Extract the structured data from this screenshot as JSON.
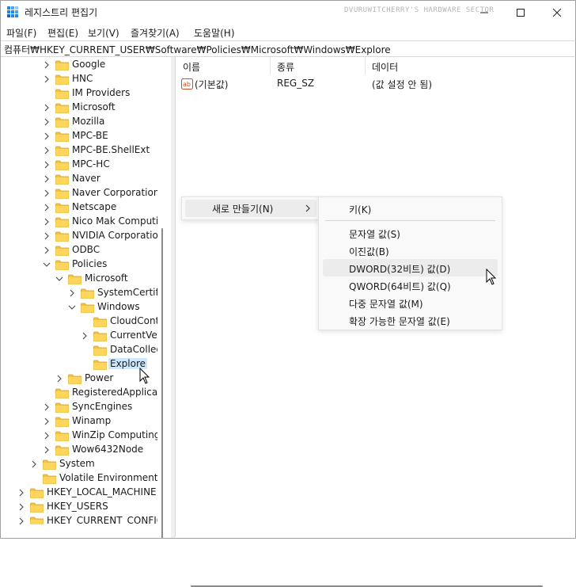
{
  "window": {
    "title": "레지스트리 편집기",
    "watermark": "DVURUWITCHERRY'S HARDWARE SECTOR",
    "minimize_icon": "minimize-icon",
    "maximize_icon": "maximize-icon",
    "close_icon": "close-icon"
  },
  "menu": [
    "파일(F)",
    "편집(E)",
    "보기(V)",
    "즐겨찾기(A)",
    "도움말(H)"
  ],
  "address": "컴퓨터₩HKEY_CURRENT_USER₩Software₩Policies₩Microsoft₩Windows₩Explore",
  "tree": [
    "Google",
    "HNC",
    "IM Providers",
    "Microsoft",
    "Mozilla",
    "MPC-BE",
    "MPC-BE.ShellExt",
    "MPC-HC",
    "Naver",
    "Naver Corporation",
    "Netscape",
    "Nico Mak Computing",
    "NVIDIA Corporation",
    "ODBC",
    "Policies",
    "Microsoft",
    "SystemCertificates",
    "Windows",
    "CloudContent",
    "CurrentVersion",
    "DataCollection",
    "Explore",
    "Power",
    "RegisteredApplications",
    "SyncEngines",
    "Winamp",
    "WinZip Computing",
    "Wow6432Node",
    "System",
    "Volatile Environment",
    "HKEY_LOCAL_MACHINE",
    "HKEY_USERS",
    "HKEY_CURRENT_CONFIG"
  ],
  "list": {
    "headers": [
      "이름",
      "종류",
      "데이터"
    ],
    "rows": [
      {
        "icon": "string-value-icon",
        "name": "(기본값)",
        "type": "REG_SZ",
        "data": "(값 설정 안 됨)"
      }
    ]
  },
  "context_menu": {
    "new_label": "새로 만들기(N)",
    "submenu": [
      "키(K)",
      "문자열 값(S)",
      "이진값(B)",
      "DWORD(32비트) 값(D)",
      "QWORD(64비트) 값(Q)",
      "다중 문자열 값(M)",
      "확장 가능한 문자열 값(E)"
    ],
    "highlighted": "DWORD(32비트) 값(D)"
  },
  "colors": {
    "selection": "#cce8ff",
    "folder": "#f5c242",
    "menu_highlight": "#ececec"
  }
}
